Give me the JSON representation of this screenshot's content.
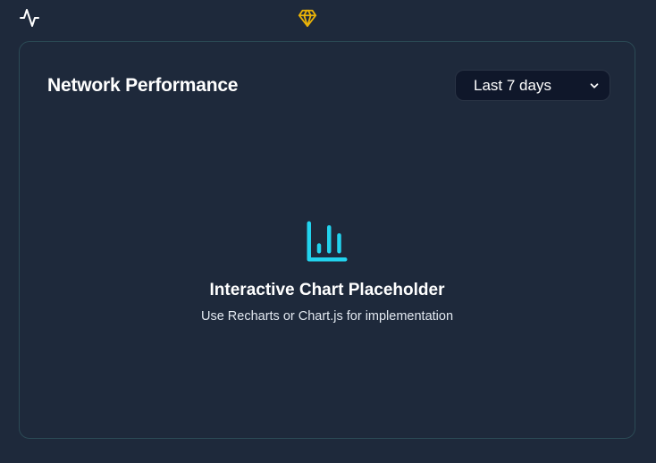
{
  "icons": {
    "activity": "activity-icon",
    "gem": "gem-icon",
    "chart": "bar-chart-icon",
    "chevron": "chevron-down-icon"
  },
  "card": {
    "title": "Network Performance",
    "range_select": {
      "selected": "Last 7 days"
    },
    "placeholder": {
      "title": "Interactive Chart Placeholder",
      "subtitle": "Use Recharts or Chart.js for implementation"
    }
  },
  "colors": {
    "background": "#1e293b",
    "card_border": "#2b4a55",
    "select_bg": "#0f172a",
    "accent_cyan": "#22d3ee",
    "gem_gold": "#eab308",
    "text_primary": "#ffffff"
  }
}
